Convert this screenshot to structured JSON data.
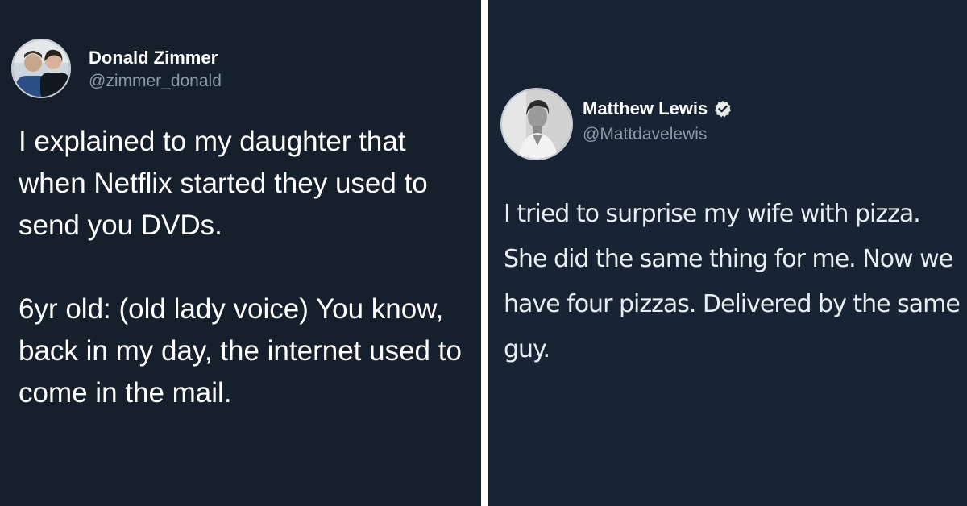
{
  "tweets": [
    {
      "name": "Donald Zimmer",
      "handle": "@zimmer_donald",
      "avatar_icon": "profile-photo-two-people",
      "verified": false,
      "paragraphs": [
        "I explained to my daughter that when Netflix started they used to send you DVDs.",
        "6yr old: (old lady voice) You know, back in my day, the internet used to come in the mail."
      ]
    },
    {
      "name": "Matthew Lewis",
      "handle": "@Mattdavelewis",
      "avatar_icon": "profile-photo-man",
      "verified": true,
      "verified_icon": "verified-badge-icon",
      "paragraphs": [
        "I tried to surprise my wife with pizza. She did the same thing for me. Now we have four pizzas. Delivered by the same guy."
      ]
    }
  ],
  "colors": {
    "left_background": "#15202c",
    "right_background": "#182333",
    "divider": "#ffffff",
    "handle_text": "#8b98a5"
  }
}
